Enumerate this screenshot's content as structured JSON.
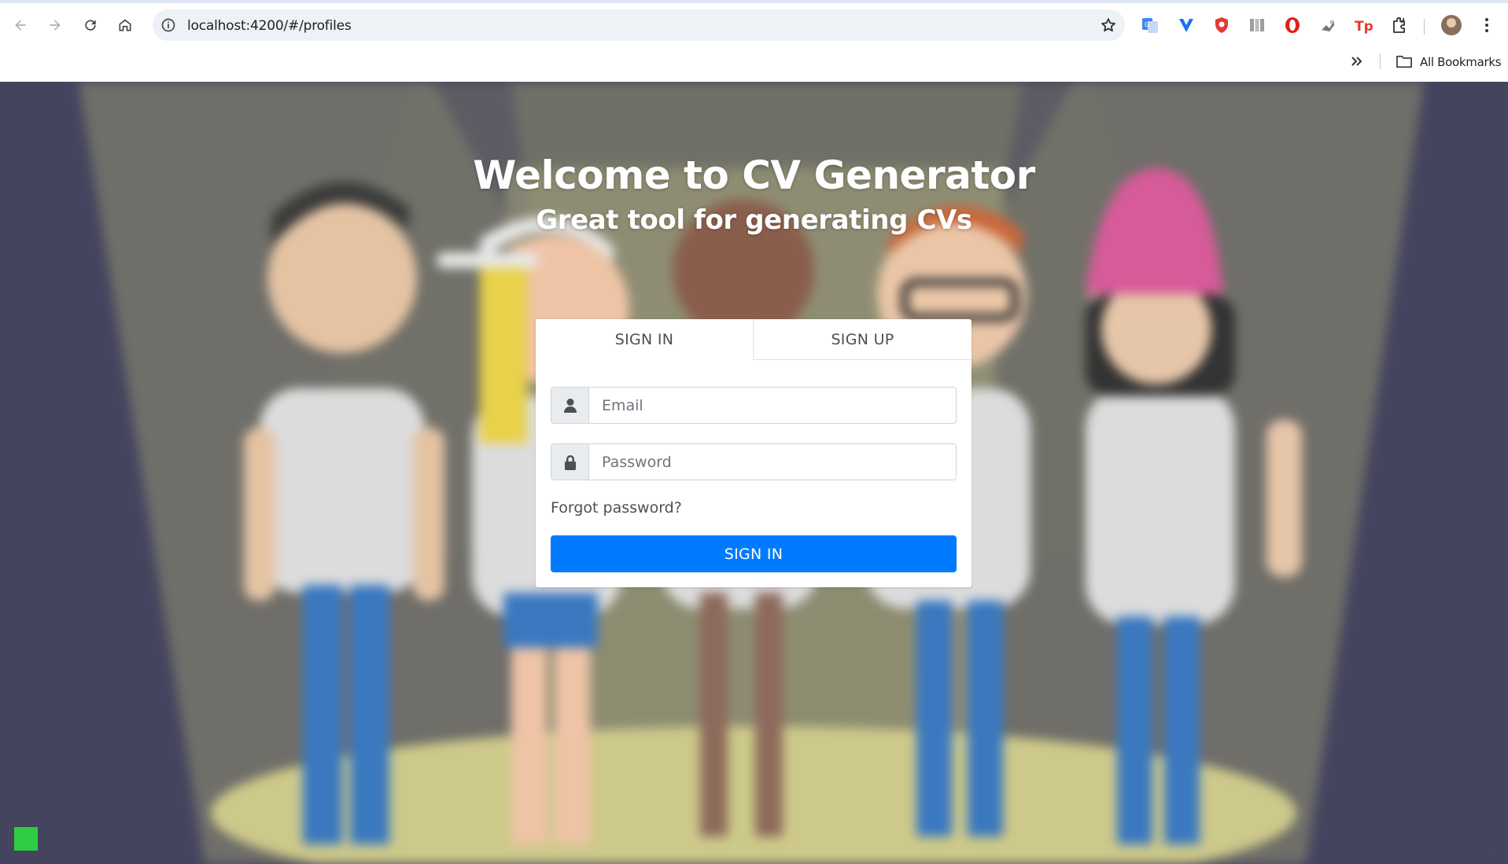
{
  "browser": {
    "url": "localhost:4200/#/profiles",
    "bookmarks_label": "All Bookmarks",
    "extensions": [
      "translate-icon",
      "vpn-extension-icon",
      "shield-extension-icon",
      "reader-extension-icon",
      "opera-extension-icon",
      "rocket-extension-icon",
      "tp-extension-icon",
      "puzzle-extensions-icon"
    ],
    "extension_colors": {
      "translate": "#4285f4",
      "vpn": "#1a73e8",
      "shield": "#e53935",
      "opera": "#e0201b",
      "tp": "#e63a2e"
    }
  },
  "page": {
    "title": "Welcome to CV Generator",
    "subtitle": "Great tool for generating CVs"
  },
  "auth": {
    "tabs": [
      {
        "label": "SIGN IN",
        "active": true
      },
      {
        "label": "SIGN UP",
        "active": false
      }
    ],
    "email_placeholder": "Email",
    "email_value": "",
    "password_placeholder": "Password",
    "password_value": "",
    "forgot_label": "Forgot password?",
    "submit_label": "SIGN IN"
  },
  "colors": {
    "primary": "#007bff",
    "background": "#44445f",
    "status_indicator": "#2ecc40"
  }
}
